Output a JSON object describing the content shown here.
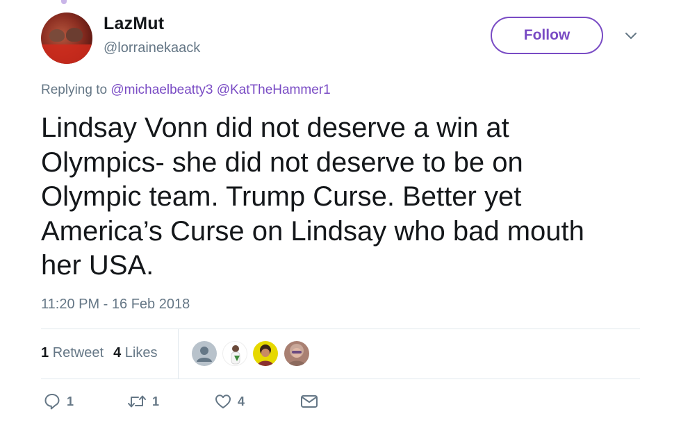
{
  "tweet": {
    "author": {
      "display_name": "LazMut",
      "handle": "@lorrainekaack",
      "avatar_icon": "cats-on-red-rug-avatar"
    },
    "follow_label": "Follow",
    "replying": {
      "prefix": "Replying to",
      "mentions": [
        "@michaelbeatty3",
        "@KatTheHammer1"
      ]
    },
    "text": "Lindsay Vonn did not deserve a win at\nOlympics- she did not deserve to be on\nOlympic team.  Trump Curse.  Better yet\nAmerica’s Curse on Lindsay who bad mouth\nher USA.",
    "timestamp": "11:20 PM - 16 Feb 2018",
    "stats": {
      "retweet_count": "1",
      "retweet_label": "Retweet",
      "like_count": "4",
      "like_label": "Likes"
    },
    "likers": [
      "default-avatar",
      "man-in-white-avatar",
      "woman-yellow-bg-avatar",
      "woman-sunglasses-avatar"
    ],
    "actions": {
      "reply_count": "1",
      "retweet_count": "1",
      "like_count": "4"
    }
  },
  "colors": {
    "accent": "#794bc4",
    "secondary_text": "#657786",
    "primary_text": "#14171a",
    "divider": "#e1e8ed"
  }
}
